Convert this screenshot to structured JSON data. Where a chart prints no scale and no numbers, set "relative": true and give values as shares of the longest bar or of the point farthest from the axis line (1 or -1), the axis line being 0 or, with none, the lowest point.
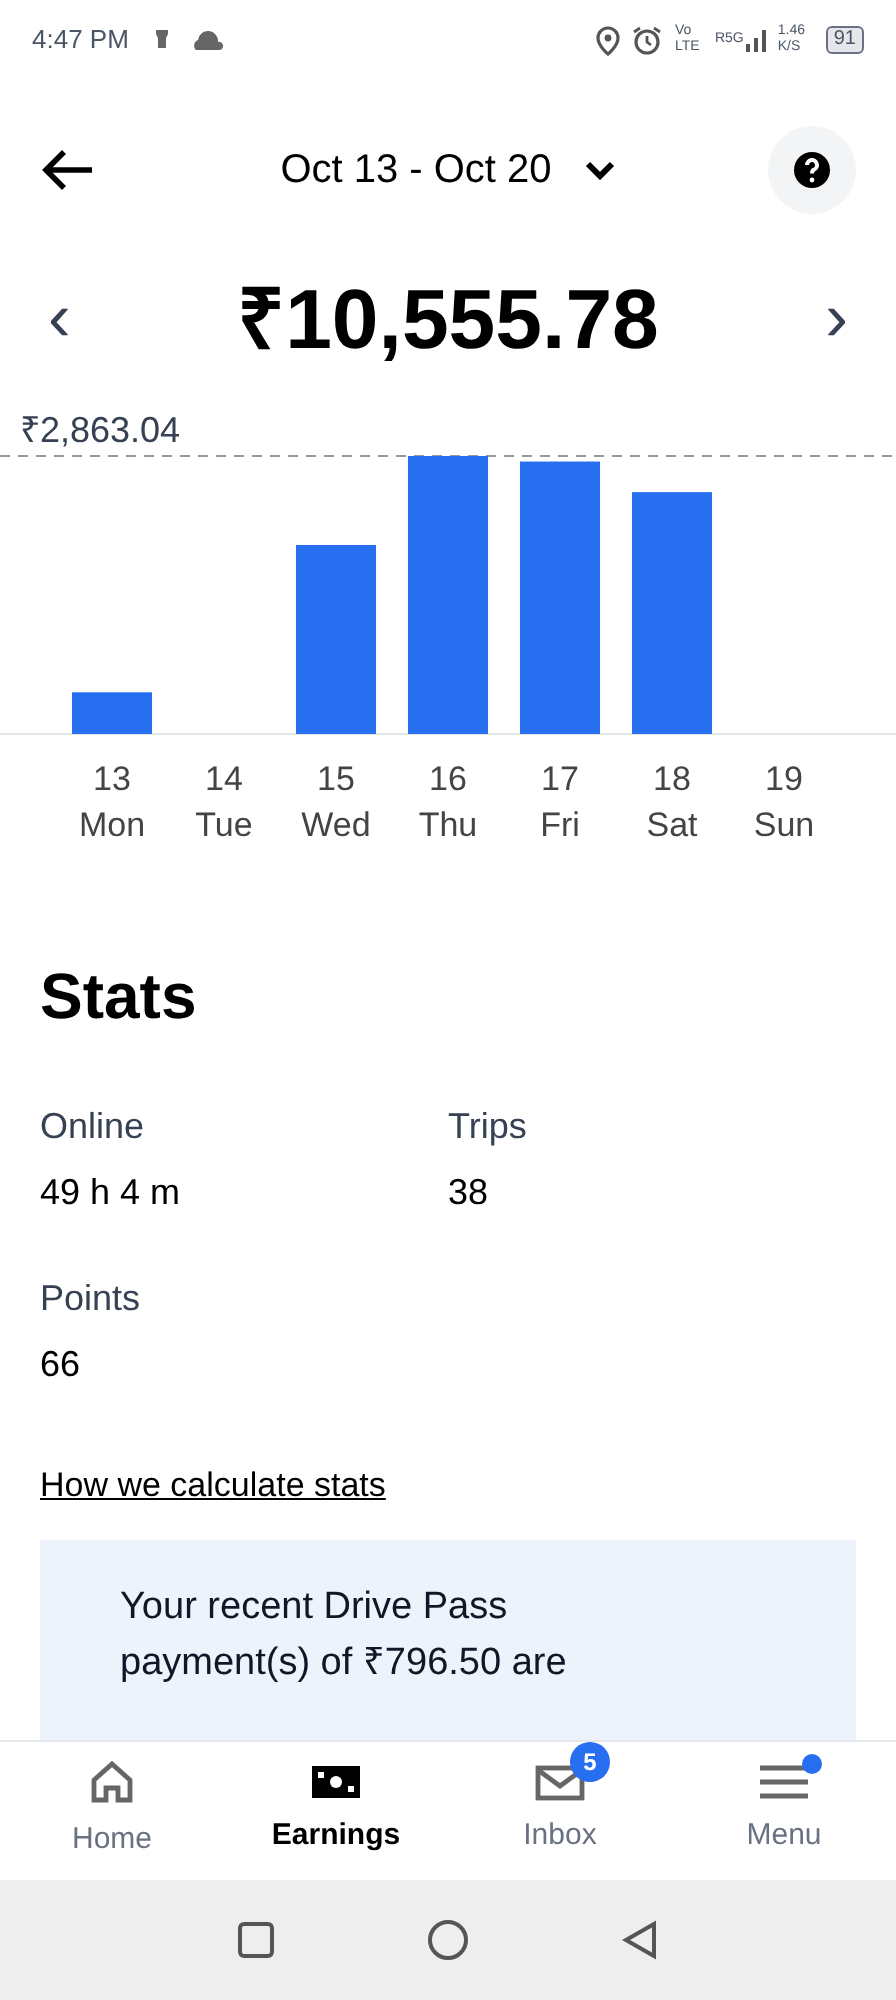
{
  "status_bar": {
    "time": "4:47 PM",
    "network": "Vo LTE",
    "carrier": "R5G",
    "speed": "1.46 K/S",
    "battery": "91"
  },
  "header": {
    "date_range": "Oct 13 - Oct 20"
  },
  "summary": {
    "prev": "‹",
    "amount": "₹10,555.78",
    "next": "›"
  },
  "chart_data": {
    "type": "bar",
    "categories": [
      "13 Mon",
      "14 Tue",
      "15 Wed",
      "16 Thu",
      "17 Fri",
      "18 Sat",
      "19 Sun"
    ],
    "values": [
      0.15,
      0,
      0.68,
      1,
      0.98,
      0.87,
      0
    ],
    "relative": true,
    "annotations": [
      "₹2,863.04"
    ]
  },
  "stats": {
    "title": "Stats",
    "items": [
      {
        "label": "Online",
        "value": "49 h 4 m"
      },
      {
        "label": "Trips",
        "value": "38"
      },
      {
        "label": "Points",
        "value": "66"
      }
    ],
    "link": "How we calculate stats"
  },
  "notice": {
    "lines": [
      "Your recent Drive Pass",
      "payment(s) of ₹796.50 are"
    ]
  },
  "nav": [
    {
      "label": "Home",
      "selected": false,
      "kind": "home"
    },
    {
      "label": "Earnings",
      "selected": true,
      "kind": "earnings"
    },
    {
      "label": "Inbox",
      "selected": false,
      "kind": "inbox",
      "badge": "5"
    },
    {
      "label": "Menu",
      "selected": false,
      "kind": "menu",
      "dot": true
    }
  ]
}
